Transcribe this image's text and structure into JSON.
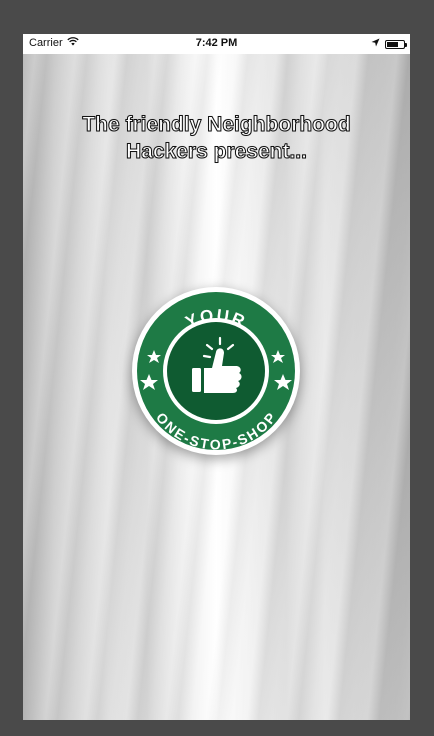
{
  "status_bar": {
    "carrier": "Carrier",
    "time": "7:42 PM",
    "battery_level": 0.7,
    "icons": [
      "wifi-icon",
      "location-arrow-icon",
      "battery-icon"
    ]
  },
  "splash": {
    "intro_line_1": "The friendly Neighborhood",
    "intro_line_2": "Hackers present...",
    "logo": {
      "top_text": "YOUR",
      "bottom_text": "ONE-STOP-SHOP",
      "icon": "thumbs-up-icon",
      "colors": {
        "ring": "#1e7a45",
        "center": "#0f5b31",
        "background": "#ffffff"
      }
    }
  }
}
